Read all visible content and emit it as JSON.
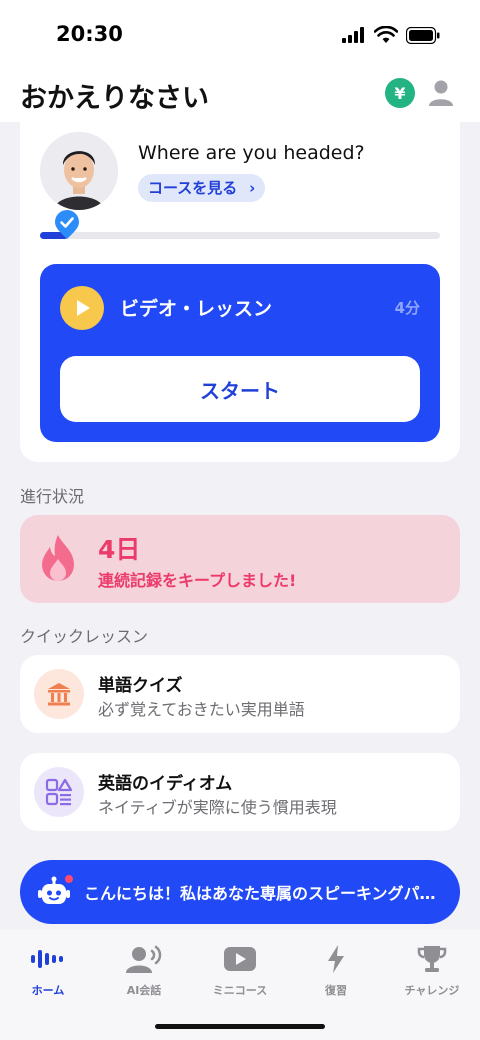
{
  "status_bar": {
    "time": "20:30"
  },
  "header": {
    "title": "おかえりなさい",
    "coin_symbol": "¥"
  },
  "course_card": {
    "question": "Where are you headed?",
    "see_courses_label": "コースを見る",
    "progress_fraction": 0.07,
    "video": {
      "title": "ビデオ・レッスン",
      "duration": "4分",
      "start_label": "スタート"
    }
  },
  "progress_section": {
    "label": "進行状況",
    "streak_days": "4日",
    "streak_message": "連続記録をキープしました!"
  },
  "quick_lessons": {
    "label": "クイックレッスン",
    "items": [
      {
        "title": "単語クイズ",
        "subtitle": "必ず覚えておきたい実用単語",
        "icon": "bank-icon"
      },
      {
        "title": "英語のイディオム",
        "subtitle": "ネイティブが実際に使う慣用表現",
        "icon": "shapes-list-icon"
      }
    ]
  },
  "chat_bar": {
    "message": "こんにちは！私はあなた専属のスピーキングパートナーです"
  },
  "tabs": [
    {
      "label": "ホーム",
      "icon": "waveform-icon",
      "active": true
    },
    {
      "label": "AI会話",
      "icon": "speaking-person-icon",
      "active": false
    },
    {
      "label": "ミニコース",
      "icon": "play-video-icon",
      "active": false
    },
    {
      "label": "復習",
      "icon": "lightning-icon",
      "active": false
    },
    {
      "label": "チャレンジ",
      "icon": "trophy-icon",
      "active": false
    }
  ],
  "colors": {
    "accent": "#2149f6",
    "accent_text": "#2140d8",
    "streak_bg": "#f5d3da",
    "streak_text": "#ec3a6b",
    "coin": "#24b383",
    "play_button": "#f7c84b"
  }
}
